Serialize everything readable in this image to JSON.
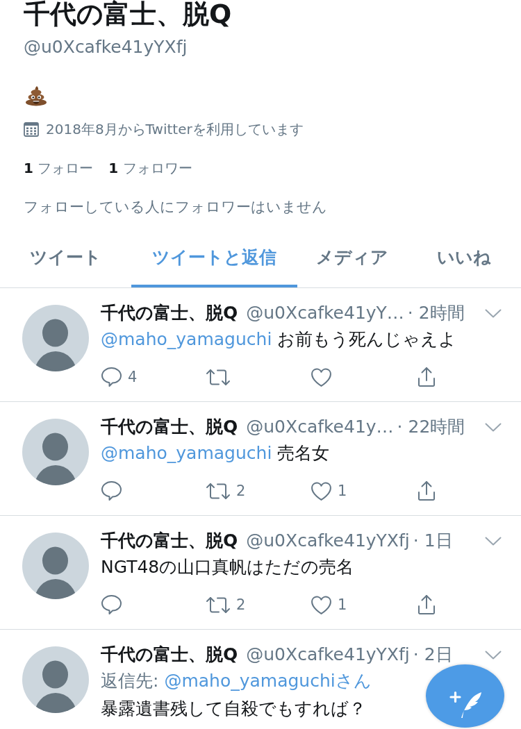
{
  "profile": {
    "name": "千代の富士、脱Q",
    "handle": "@u0Xcafke41yYXfj",
    "joined": "2018年8月からTwitterを利用しています",
    "following": {
      "count": "1",
      "label": "フォロー"
    },
    "followers": {
      "count": "1",
      "label": "フォロワー"
    },
    "followers_note": "フォローしている人にフォロワーはいません"
  },
  "tabs": [
    {
      "label": "ツイート",
      "selected": false
    },
    {
      "label": "ツイートと返信",
      "selected": true
    },
    {
      "label": "メディア",
      "selected": false
    },
    {
      "label": "いいね",
      "selected": false
    }
  ],
  "tweets": [
    {
      "name": "千代の富士、脱Q",
      "handle": "@u0Xcafke41yY…",
      "time": "· 2時間",
      "mention": "@maho_yamaguchi",
      "text": "お前もう死んじゃえよ",
      "actions": [
        {
          "kind": "reply",
          "count": "4"
        },
        {
          "kind": "retweet"
        },
        {
          "kind": "like"
        },
        {
          "kind": "share"
        }
      ]
    },
    {
      "name": "千代の富士、脱Q",
      "handle": "@u0Xcafke41y…",
      "time": "· 22時間",
      "mention": "@maho_yamaguchi",
      "text": "売名女",
      "actions": [
        {
          "kind": "reply"
        },
        {
          "kind": "retweet",
          "count": "2"
        },
        {
          "kind": "like",
          "count": "1"
        },
        {
          "kind": "share"
        }
      ]
    },
    {
      "name": "千代の富士、脱Q",
      "handle": "@u0Xcafke41yYXfj",
      "time": "· 1日",
      "text": "NGT48の山口真帆はただの売名",
      "actions": [
        {
          "kind": "reply"
        },
        {
          "kind": "retweet",
          "count": "2"
        },
        {
          "kind": "like",
          "count": "1"
        },
        {
          "kind": "share"
        }
      ]
    },
    {
      "name": "千代の富士、脱Q",
      "handle": "@u0Xcafke41yYXfj",
      "time": "· 2日",
      "reply_to": {
        "label": "返信先:",
        "mention": "@maho_yamaguchiさん"
      },
      "text": "暴露遺書残して自殺でもすれば？"
    }
  ]
}
